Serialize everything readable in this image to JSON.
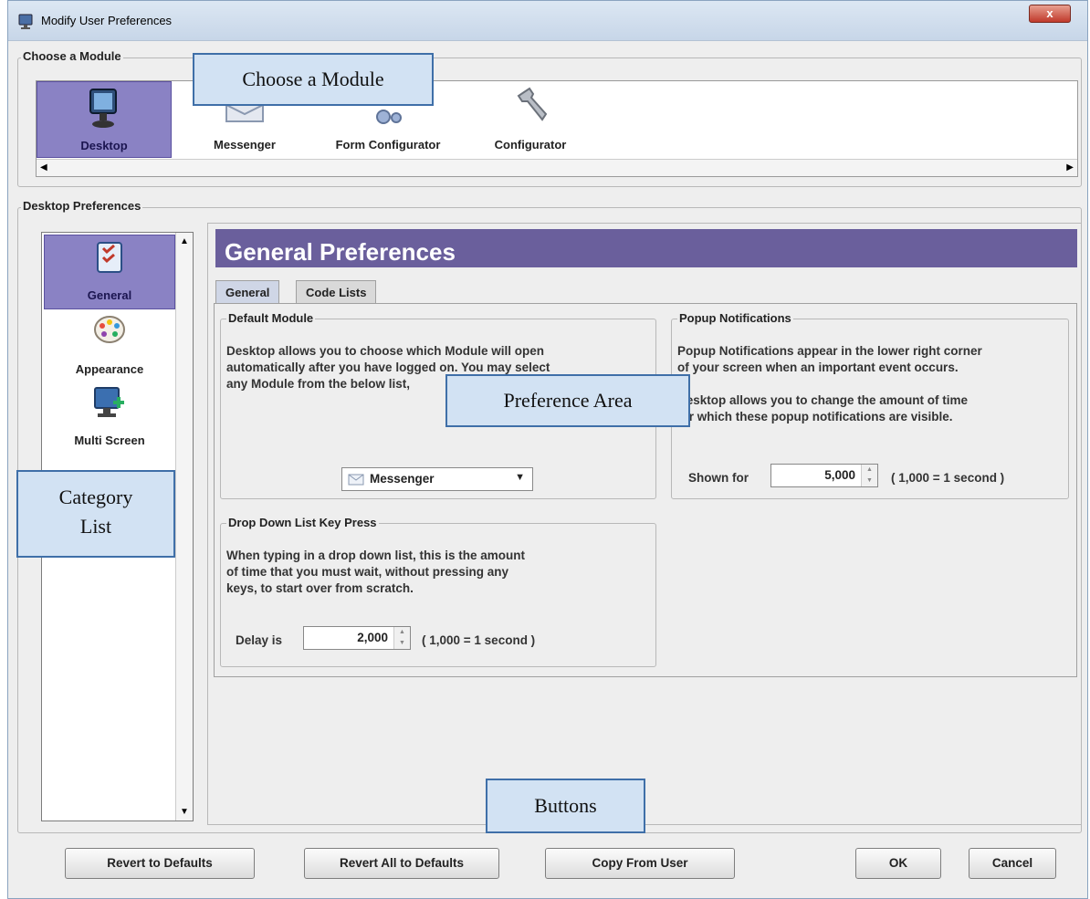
{
  "window": {
    "title": "Modify User Preferences",
    "close_glyph": "x"
  },
  "module_group": {
    "legend": "Choose a Module",
    "modules": [
      {
        "label": "Desktop",
        "icon": "monitor-icon",
        "selected": true
      },
      {
        "label": "Messenger",
        "icon": "envelope-icon",
        "selected": false
      },
      {
        "label": "Form Configurator",
        "icon": "gears-icon",
        "selected": false
      },
      {
        "label": "Configurator",
        "icon": "wrench-icon",
        "selected": false
      }
    ]
  },
  "desktop_group": {
    "legend": "Desktop Preferences"
  },
  "categories": [
    {
      "label": "General",
      "icon": "checklist-icon",
      "selected": true
    },
    {
      "label": "Appearance",
      "icon": "palette-icon",
      "selected": false
    },
    {
      "label": "Multi Screen",
      "icon": "monitor-plus-icon",
      "selected": false
    }
  ],
  "panel": {
    "header": "General Preferences",
    "tabs": [
      {
        "label": "General",
        "active": true
      },
      {
        "label": "Code Lists",
        "active": false
      }
    ],
    "default_module": {
      "legend": "Default Module",
      "lines": [
        "Desktop allows you to choose which Module will open",
        "automatically after you have logged on.  You may select",
        "any Module from the below list,"
      ],
      "selected": "Messenger"
    },
    "popup": {
      "legend": "Popup Notifications",
      "lines": [
        "Popup Notifications appear in the lower right corner",
        "of your screen when an important event occurs.",
        "",
        "Desktop allows you to change the amount of time",
        "for which these popup notifications are visible."
      ],
      "shown_label": "Shown for",
      "shown_value": "5,000",
      "unit_note": "( 1,000 = 1 second )"
    },
    "dropdown": {
      "legend": "Drop Down List Key Press",
      "lines": [
        "When typing in a drop down list, this is the amount",
        "of time that you must wait, without pressing any",
        "keys, to start over from scratch."
      ],
      "delay_label": "Delay is",
      "delay_value": "2,000",
      "unit_note": "( 1,000 = 1 second )"
    }
  },
  "buttons": {
    "revert": "Revert to Defaults",
    "revert_all": "Revert All to Defaults",
    "copy": "Copy From User",
    "ok": "OK",
    "cancel": "Cancel"
  },
  "callouts": {
    "choose_module": "Choose a Module",
    "category_list": "Category List",
    "preference_area": "Preference Area",
    "buttons": "Buttons"
  },
  "colors": {
    "selection": "#8a82c4",
    "header_bar": "#6a5f9c",
    "callout_fill": "#d2e2f3",
    "callout_border": "#3f6fa8"
  }
}
